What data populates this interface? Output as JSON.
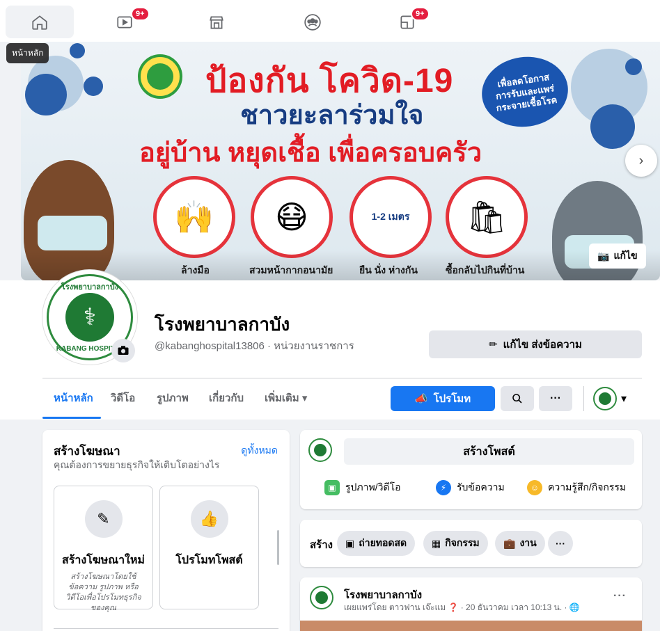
{
  "nav": {
    "tooltip": "หน้าหลัก",
    "tabs": [
      {
        "name": "home",
        "badge": ""
      },
      {
        "name": "watch",
        "badge": "9+"
      },
      {
        "name": "marketplace",
        "badge": ""
      },
      {
        "name": "groups",
        "badge": ""
      },
      {
        "name": "gaming",
        "badge": "9+"
      }
    ]
  },
  "cover": {
    "line1": "ป้องกัน โควิด-19",
    "line2": "ชาวยะลาร่วมใจ",
    "line3": "อยู่บ้าน หยุดเชื้อ เพื่อครอบครัว",
    "bubble": [
      "เพื่อลดโอกาส",
      "การรับและแพร่",
      "กระจายเชื้อโรค"
    ],
    "distance": "1-2 เมตร",
    "captions": [
      "ล้างมือ",
      "สวมหน้ากากอนามัย",
      "ยืน นั่ง ห่างกัน",
      "ซื้อกลับไปกินที่บ้าน"
    ],
    "edit_label": "แก้ไข"
  },
  "profile": {
    "name": "โรงพยาบาลกาบัง",
    "handle": "@kabanghospital13806 · หน่วยงานราชการ",
    "avatar_top_text": "โรงพยาบาลกาบัง",
    "avatar_bottom_text": "KABANG HOSPITAL",
    "edit_message_label": "แก้ไข ส่งข้อความ"
  },
  "tabs": {
    "items": [
      "หน้าหลัก",
      "วิดีโอ",
      "รูปภาพ",
      "เกี่ยวกับ",
      "เพิ่มเติม ▾"
    ],
    "promote": "โปรโมท",
    "more": "···"
  },
  "ads": {
    "title": "สร้างโฆษณา",
    "see_all": "ดูทั้งหมด",
    "subtitle": "คุณต้องการขยายธุรกิจให้เติบโตอย่างไร",
    "options": [
      {
        "title": "สร้างโฆษณาใหม่",
        "desc": "สร้างโฆษณาโดยใช้ข้อความ รูปภาพ หรือวิดีโอเพื่อโปรโมทธุรกิจของคุณ"
      },
      {
        "title": "โปรโมทโพสต์",
        "desc": ""
      }
    ]
  },
  "composer": {
    "prompt": "สร้างโพสต์",
    "actions": [
      "รูปภาพ/วิดีโอ",
      "รับข้อความ",
      "ความรู้สึก/กิจกรรม"
    ]
  },
  "create": {
    "label": "สร้าง",
    "chips": [
      "ถ่ายทอดสด",
      "กิจกรรม",
      "งาน"
    ],
    "more": "···"
  },
  "feed": {
    "name": "โรงพยาบาลกาบัง",
    "meta": "เผยแพร่โดย ตาวฟาน เจ๊ะแม ❓ · 20 ธันวาคม เวลา 10:13 น. · 🌐",
    "more": "···"
  },
  "colors": {
    "accent": "#1877f2",
    "badge": "#e41e3f",
    "cover_red": "#e21c24",
    "cover_blue": "#173d82"
  }
}
